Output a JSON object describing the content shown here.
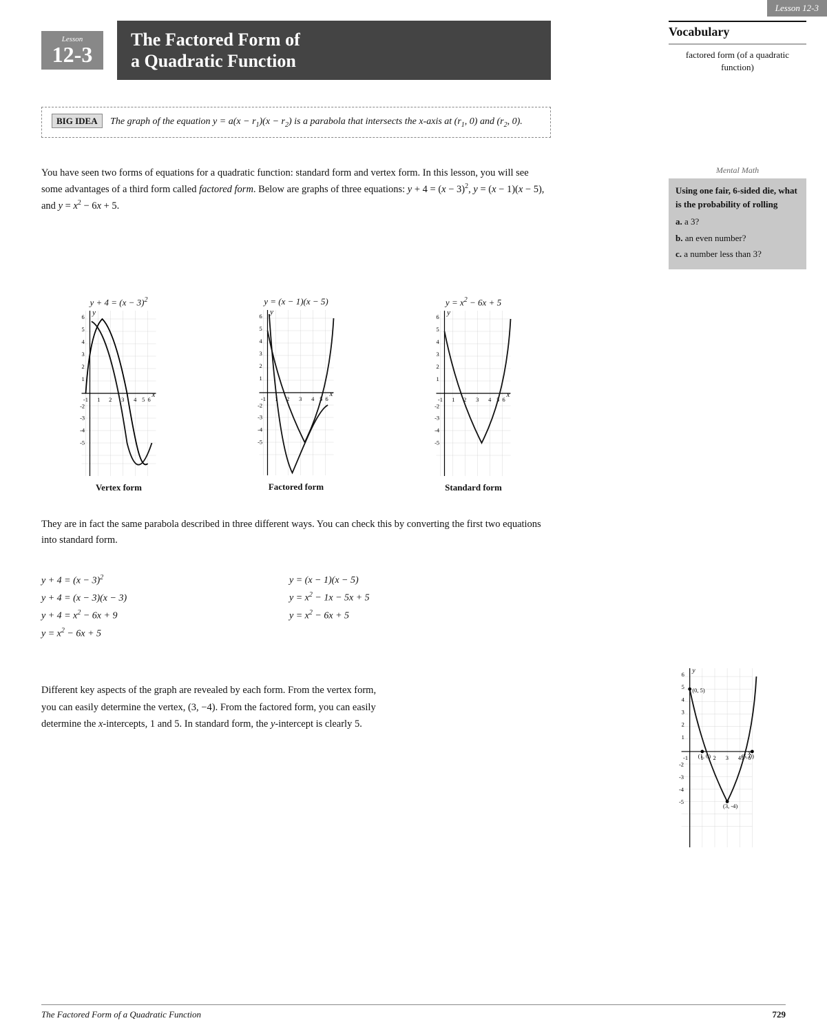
{
  "page": {
    "lesson_label": "Lesson",
    "lesson_number": "12-3",
    "title_line1": "The Factored Form of",
    "title_line2": "a Quadratic Function",
    "top_right_label": "Lesson 12-3",
    "footer_title": "The Factored Form of a Quadratic Function",
    "footer_page": "729"
  },
  "vocabulary": {
    "heading": "Vocabulary",
    "term": "factored form (of a quadratic function)"
  },
  "big_idea": {
    "label": "BIG IDEA",
    "text": "The graph of the equation y = a(x − r₁)(x − r₂) is a parabola that intersects the x-axis at (r₁, 0) and (r₂, 0)."
  },
  "intro_paragraph": "You have seen two forms of equations for a quadratic function: standard form and vertex form. In this lesson, you will see some advantages of a third form called factored form. Below are graphs of three equations: y + 4 = (x − 3)², y = (x − 1)(x − 5), and y = x² − 6x + 5.",
  "mental_math": {
    "title": "Mental Math",
    "heading": "Using one fair, 6-sided die, what is the probability of rolling",
    "questions": [
      {
        "label": "a.",
        "text": "a 3?"
      },
      {
        "label": "b.",
        "text": "an even number?"
      },
      {
        "label": "c.",
        "text": "a number less than 3?"
      }
    ]
  },
  "graphs": [
    {
      "equation": "y + 4 = (x − 3)²",
      "label": "Vertex form"
    },
    {
      "equation": "y = (x − 1)(x − 5)",
      "label": "Factored form"
    },
    {
      "equation": "y = x² − 6x + 5",
      "label": "Standard form"
    }
  ],
  "below_graphs_text": "They are in fact the same parabola described in three different ways. You can check this by converting the first two equations into standard form.",
  "equations_left": [
    "y + 4 = (x − 3)²",
    "y + 4 = (x − 3)(x − 3)",
    "y + 4 = x² − 6x + 9",
    "y = x² − 6x + 5"
  ],
  "equations_right": [
    "y = (x − 1)(x − 5)",
    "y = x² − 1x − 5x + 5",
    "y = x² − 6x + 5",
    ""
  ],
  "lower_text": "Different key aspects of the graph are revealed by each form. From the vertex form, you can easily determine the vertex, (3, −4). From the factored form, you can easily determine the x-intercepts, 1 and 5. In standard form, the y-intercept is clearly 5."
}
